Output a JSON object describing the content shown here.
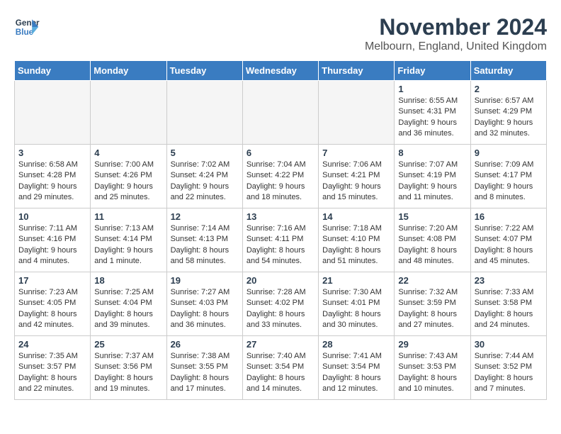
{
  "header": {
    "logo_line1": "General",
    "logo_line2": "Blue",
    "month": "November 2024",
    "location": "Melbourn, England, United Kingdom"
  },
  "days_of_week": [
    "Sunday",
    "Monday",
    "Tuesday",
    "Wednesday",
    "Thursday",
    "Friday",
    "Saturday"
  ],
  "weeks": [
    [
      {
        "day": "",
        "info": ""
      },
      {
        "day": "",
        "info": ""
      },
      {
        "day": "",
        "info": ""
      },
      {
        "day": "",
        "info": ""
      },
      {
        "day": "",
        "info": ""
      },
      {
        "day": "1",
        "info": "Sunrise: 6:55 AM\nSunset: 4:31 PM\nDaylight: 9 hours and 36 minutes."
      },
      {
        "day": "2",
        "info": "Sunrise: 6:57 AM\nSunset: 4:29 PM\nDaylight: 9 hours and 32 minutes."
      }
    ],
    [
      {
        "day": "3",
        "info": "Sunrise: 6:58 AM\nSunset: 4:28 PM\nDaylight: 9 hours and 29 minutes."
      },
      {
        "day": "4",
        "info": "Sunrise: 7:00 AM\nSunset: 4:26 PM\nDaylight: 9 hours and 25 minutes."
      },
      {
        "day": "5",
        "info": "Sunrise: 7:02 AM\nSunset: 4:24 PM\nDaylight: 9 hours and 22 minutes."
      },
      {
        "day": "6",
        "info": "Sunrise: 7:04 AM\nSunset: 4:22 PM\nDaylight: 9 hours and 18 minutes."
      },
      {
        "day": "7",
        "info": "Sunrise: 7:06 AM\nSunset: 4:21 PM\nDaylight: 9 hours and 15 minutes."
      },
      {
        "day": "8",
        "info": "Sunrise: 7:07 AM\nSunset: 4:19 PM\nDaylight: 9 hours and 11 minutes."
      },
      {
        "day": "9",
        "info": "Sunrise: 7:09 AM\nSunset: 4:17 PM\nDaylight: 9 hours and 8 minutes."
      }
    ],
    [
      {
        "day": "10",
        "info": "Sunrise: 7:11 AM\nSunset: 4:16 PM\nDaylight: 9 hours and 4 minutes."
      },
      {
        "day": "11",
        "info": "Sunrise: 7:13 AM\nSunset: 4:14 PM\nDaylight: 9 hours and 1 minute."
      },
      {
        "day": "12",
        "info": "Sunrise: 7:14 AM\nSunset: 4:13 PM\nDaylight: 8 hours and 58 minutes."
      },
      {
        "day": "13",
        "info": "Sunrise: 7:16 AM\nSunset: 4:11 PM\nDaylight: 8 hours and 54 minutes."
      },
      {
        "day": "14",
        "info": "Sunrise: 7:18 AM\nSunset: 4:10 PM\nDaylight: 8 hours and 51 minutes."
      },
      {
        "day": "15",
        "info": "Sunrise: 7:20 AM\nSunset: 4:08 PM\nDaylight: 8 hours and 48 minutes."
      },
      {
        "day": "16",
        "info": "Sunrise: 7:22 AM\nSunset: 4:07 PM\nDaylight: 8 hours and 45 minutes."
      }
    ],
    [
      {
        "day": "17",
        "info": "Sunrise: 7:23 AM\nSunset: 4:05 PM\nDaylight: 8 hours and 42 minutes."
      },
      {
        "day": "18",
        "info": "Sunrise: 7:25 AM\nSunset: 4:04 PM\nDaylight: 8 hours and 39 minutes."
      },
      {
        "day": "19",
        "info": "Sunrise: 7:27 AM\nSunset: 4:03 PM\nDaylight: 8 hours and 36 minutes."
      },
      {
        "day": "20",
        "info": "Sunrise: 7:28 AM\nSunset: 4:02 PM\nDaylight: 8 hours and 33 minutes."
      },
      {
        "day": "21",
        "info": "Sunrise: 7:30 AM\nSunset: 4:01 PM\nDaylight: 8 hours and 30 minutes."
      },
      {
        "day": "22",
        "info": "Sunrise: 7:32 AM\nSunset: 3:59 PM\nDaylight: 8 hours and 27 minutes."
      },
      {
        "day": "23",
        "info": "Sunrise: 7:33 AM\nSunset: 3:58 PM\nDaylight: 8 hours and 24 minutes."
      }
    ],
    [
      {
        "day": "24",
        "info": "Sunrise: 7:35 AM\nSunset: 3:57 PM\nDaylight: 8 hours and 22 minutes."
      },
      {
        "day": "25",
        "info": "Sunrise: 7:37 AM\nSunset: 3:56 PM\nDaylight: 8 hours and 19 minutes."
      },
      {
        "day": "26",
        "info": "Sunrise: 7:38 AM\nSunset: 3:55 PM\nDaylight: 8 hours and 17 minutes."
      },
      {
        "day": "27",
        "info": "Sunrise: 7:40 AM\nSunset: 3:54 PM\nDaylight: 8 hours and 14 minutes."
      },
      {
        "day": "28",
        "info": "Sunrise: 7:41 AM\nSunset: 3:54 PM\nDaylight: 8 hours and 12 minutes."
      },
      {
        "day": "29",
        "info": "Sunrise: 7:43 AM\nSunset: 3:53 PM\nDaylight: 8 hours and 10 minutes."
      },
      {
        "day": "30",
        "info": "Sunrise: 7:44 AM\nSunset: 3:52 PM\nDaylight: 8 hours and 7 minutes."
      }
    ]
  ]
}
